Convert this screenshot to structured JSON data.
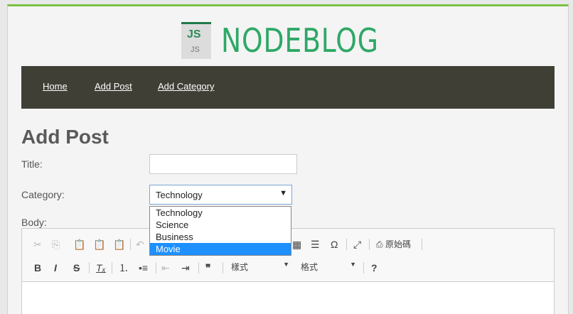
{
  "logo": {
    "badge_top": "JS",
    "badge_bottom": "JS",
    "text": "NODEBLOG"
  },
  "nav": {
    "items": [
      "Home",
      "Add Post",
      "Add Category"
    ]
  },
  "page_title": "Add Post",
  "form": {
    "title_label": "Title:",
    "title_value": "",
    "category_label": "Category:",
    "category_selected": "Technology",
    "category_options": [
      "Technology",
      "Science",
      "Business",
      "Movie"
    ],
    "category_highlighted": "Movie",
    "body_label": "Body:"
  },
  "editor": {
    "source_label": "原始碼",
    "styles_label": "樣式",
    "format_label": "格式",
    "help_label": "?"
  },
  "colors": {
    "accent": "#7ac142",
    "nav_bg": "#3f3f36",
    "logo_green": "#2ea866",
    "highlight": "#1e90ff"
  }
}
